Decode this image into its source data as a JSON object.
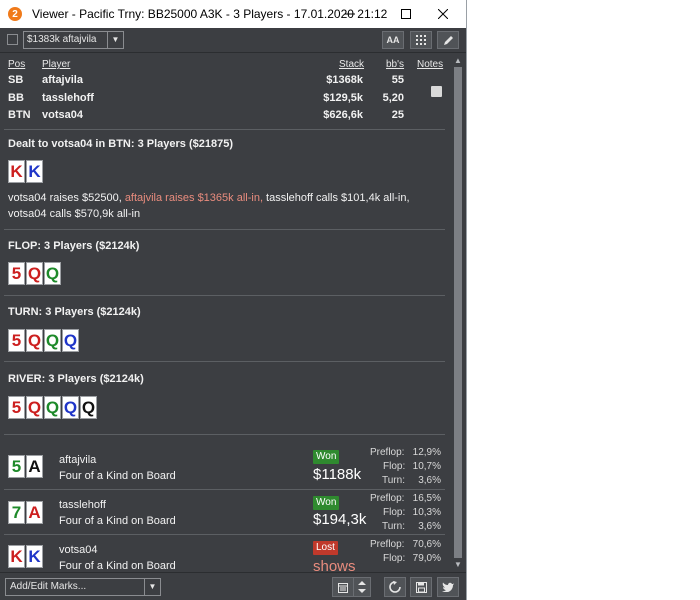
{
  "window": {
    "title": "Viewer - Pacific Trny: BB25000 A3K - 3 Players - 17.01.2020 21:12",
    "app_icon": "2"
  },
  "toolbar": {
    "player_select": "$1383k aftajvila",
    "font_button": "AA"
  },
  "table_headers": {
    "pos": "Pos",
    "player": "Player",
    "stack": "Stack",
    "bbs": "bb's",
    "notes": "Notes"
  },
  "players": [
    {
      "pos": "SB",
      "name": "aftajvila",
      "stack": "$1368k",
      "bbs": "55"
    },
    {
      "pos": "BB",
      "name": "tasslehoff",
      "stack": "$129,5k",
      "bbs": "5,20"
    },
    {
      "pos": "BTN",
      "name": "votsa04",
      "stack": "$626,6k",
      "bbs": "25"
    }
  ],
  "preflop": {
    "title": "Dealt to votsa04 in BTN: 3 Players ($21875)",
    "hole_cards": [
      {
        "rank": "K",
        "suit_color": "#cc1f1f"
      },
      {
        "rank": "K",
        "suit_color": "#1f35c8"
      }
    ],
    "action_1": "votsa04 raises $52500, ",
    "action_highlight": "aftajvila raises $1365k all-in,",
    "action_2": " tasslehoff calls $101,4k all-in, votsa04 calls $570,9k all-in"
  },
  "flop": {
    "title": "FLOP: 3 Players ($2124k)",
    "cards": [
      {
        "rank": "5",
        "suit_color": "#cc1f1f"
      },
      {
        "rank": "Q",
        "suit_color": "#cc1f1f"
      },
      {
        "rank": "Q",
        "suit_color": "#1e8a2a"
      }
    ]
  },
  "turn": {
    "title": "TURN: 3 Players ($2124k)",
    "cards": [
      {
        "rank": "5",
        "suit_color": "#cc1f1f"
      },
      {
        "rank": "Q",
        "suit_color": "#cc1f1f"
      },
      {
        "rank": "Q",
        "suit_color": "#1e8a2a"
      },
      {
        "rank": "Q",
        "suit_color": "#1f35c8"
      }
    ]
  },
  "river": {
    "title": "RIVER: 3 Players ($2124k)",
    "cards": [
      {
        "rank": "5",
        "suit_color": "#cc1f1f"
      },
      {
        "rank": "Q",
        "suit_color": "#cc1f1f"
      },
      {
        "rank": "Q",
        "suit_color": "#1e8a2a"
      },
      {
        "rank": "Q",
        "suit_color": "#1f35c8"
      },
      {
        "rank": "Q",
        "suit_color": "#111111"
      }
    ]
  },
  "stats_labels": {
    "preflop": "Preflop:",
    "flop": "Flop:",
    "turn": "Turn:"
  },
  "results": [
    {
      "name": "aftajvila",
      "hand": "Four of a Kind on Board",
      "cards": [
        {
          "rank": "5",
          "suit_color": "#1e8a2a"
        },
        {
          "rank": "A",
          "suit_color": "#111111"
        }
      ],
      "status": "Won",
      "status_color": "#2f8a2f",
      "amount": "$1188k",
      "preflop": "12,9%",
      "flop": "10,7%",
      "turn": "3,6%"
    },
    {
      "name": "tasslehoff",
      "hand": "Four of a Kind on Board",
      "cards": [
        {
          "rank": "7",
          "suit_color": "#1e8a2a"
        },
        {
          "rank": "A",
          "suit_color": "#cc1f1f"
        }
      ],
      "status": "Won",
      "status_color": "#2f8a2f",
      "amount": "$194,3k",
      "preflop": "16,5%",
      "flop": "10,3%",
      "turn": "3,6%"
    },
    {
      "name": "votsa04",
      "hand": "Four of a Kind on Board",
      "cards": [
        {
          "rank": "K",
          "suit_color": "#cc1f1f"
        },
        {
          "rank": "K",
          "suit_color": "#1f35c8"
        }
      ],
      "status": "Lost",
      "status_color": "#c0392b",
      "amount": "shows",
      "preflop": "70,6%",
      "flop": "79,0%",
      "turn": ""
    }
  ],
  "bottombar": {
    "marks_label": "Add/Edit Marks..."
  },
  "icons": [
    "app-logo-icon",
    "minimize-icon",
    "maximize-icon",
    "close-icon",
    "grid-icon",
    "pencil-icon",
    "note-icon",
    "calendar-icon",
    "updown-icon",
    "replay-icon",
    "save-icon",
    "twitter-icon"
  ]
}
